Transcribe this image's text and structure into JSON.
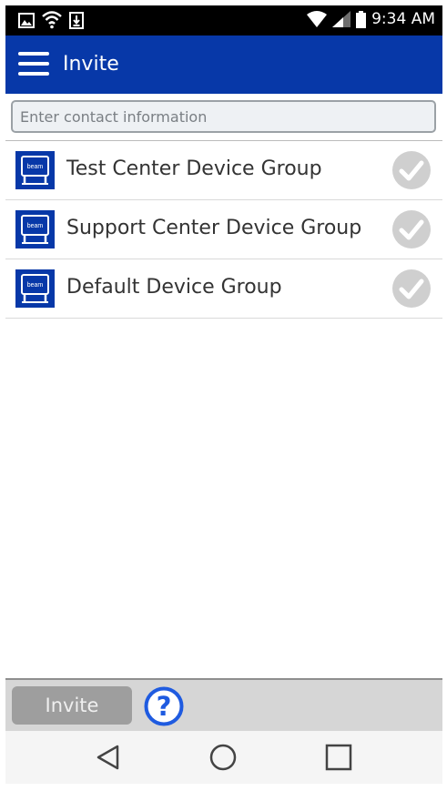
{
  "status_bar": {
    "time": "9:34 AM",
    "icons": [
      "gallery-icon",
      "wifi-outline-icon",
      "download-icon",
      "wifi-icon",
      "signal-icon",
      "battery-icon"
    ]
  },
  "app_bar": {
    "title": "Invite",
    "menu_icon": "hamburger-menu-icon",
    "background": "#0738a8"
  },
  "search": {
    "placeholder": "Enter contact information",
    "value": ""
  },
  "groups": [
    {
      "label": "Test Center Device Group",
      "icon": "beam-device-icon",
      "logo_text": "beam",
      "check_icon": "check-circle-icon"
    },
    {
      "label": "Support Center Device Group",
      "icon": "beam-device-icon",
      "logo_text": "beam",
      "check_icon": "check-circle-icon"
    },
    {
      "label": "Default Device Group",
      "icon": "beam-device-icon",
      "logo_text": "beam",
      "check_icon": "check-circle-icon"
    }
  ],
  "bottom_bar": {
    "invite_label": "Invite",
    "help_icon": "help-circle-icon"
  },
  "nav_bar": {
    "icons": [
      "back-icon",
      "home-icon",
      "recents-icon"
    ]
  },
  "colors": {
    "accent": "#0738a8",
    "help": "#1f5be0",
    "disabled_button": "#9e9e9e",
    "check": "#cfcfcf"
  }
}
